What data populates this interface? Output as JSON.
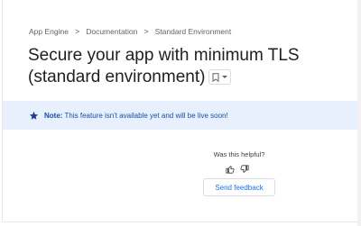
{
  "breadcrumb": {
    "items": [
      "App Engine",
      "Documentation",
      "Standard Environment"
    ],
    "separator": ">"
  },
  "page": {
    "title": "Secure your app with minimum TLS (standard environment)"
  },
  "note": {
    "label": "Note:",
    "text": " This feature isn't available yet and will be live soon!",
    "icon": "star-icon",
    "background": "#e8f0fe",
    "color": "#174ea6"
  },
  "feedback": {
    "question": "Was this helpful?",
    "thumbs_up_icon": "thumbs-up-icon",
    "thumbs_down_icon": "thumbs-down-icon",
    "button_label": "Send feedback"
  },
  "colors": {
    "accent": "#1a73e8",
    "text": "#202124",
    "muted": "#5f6368"
  }
}
